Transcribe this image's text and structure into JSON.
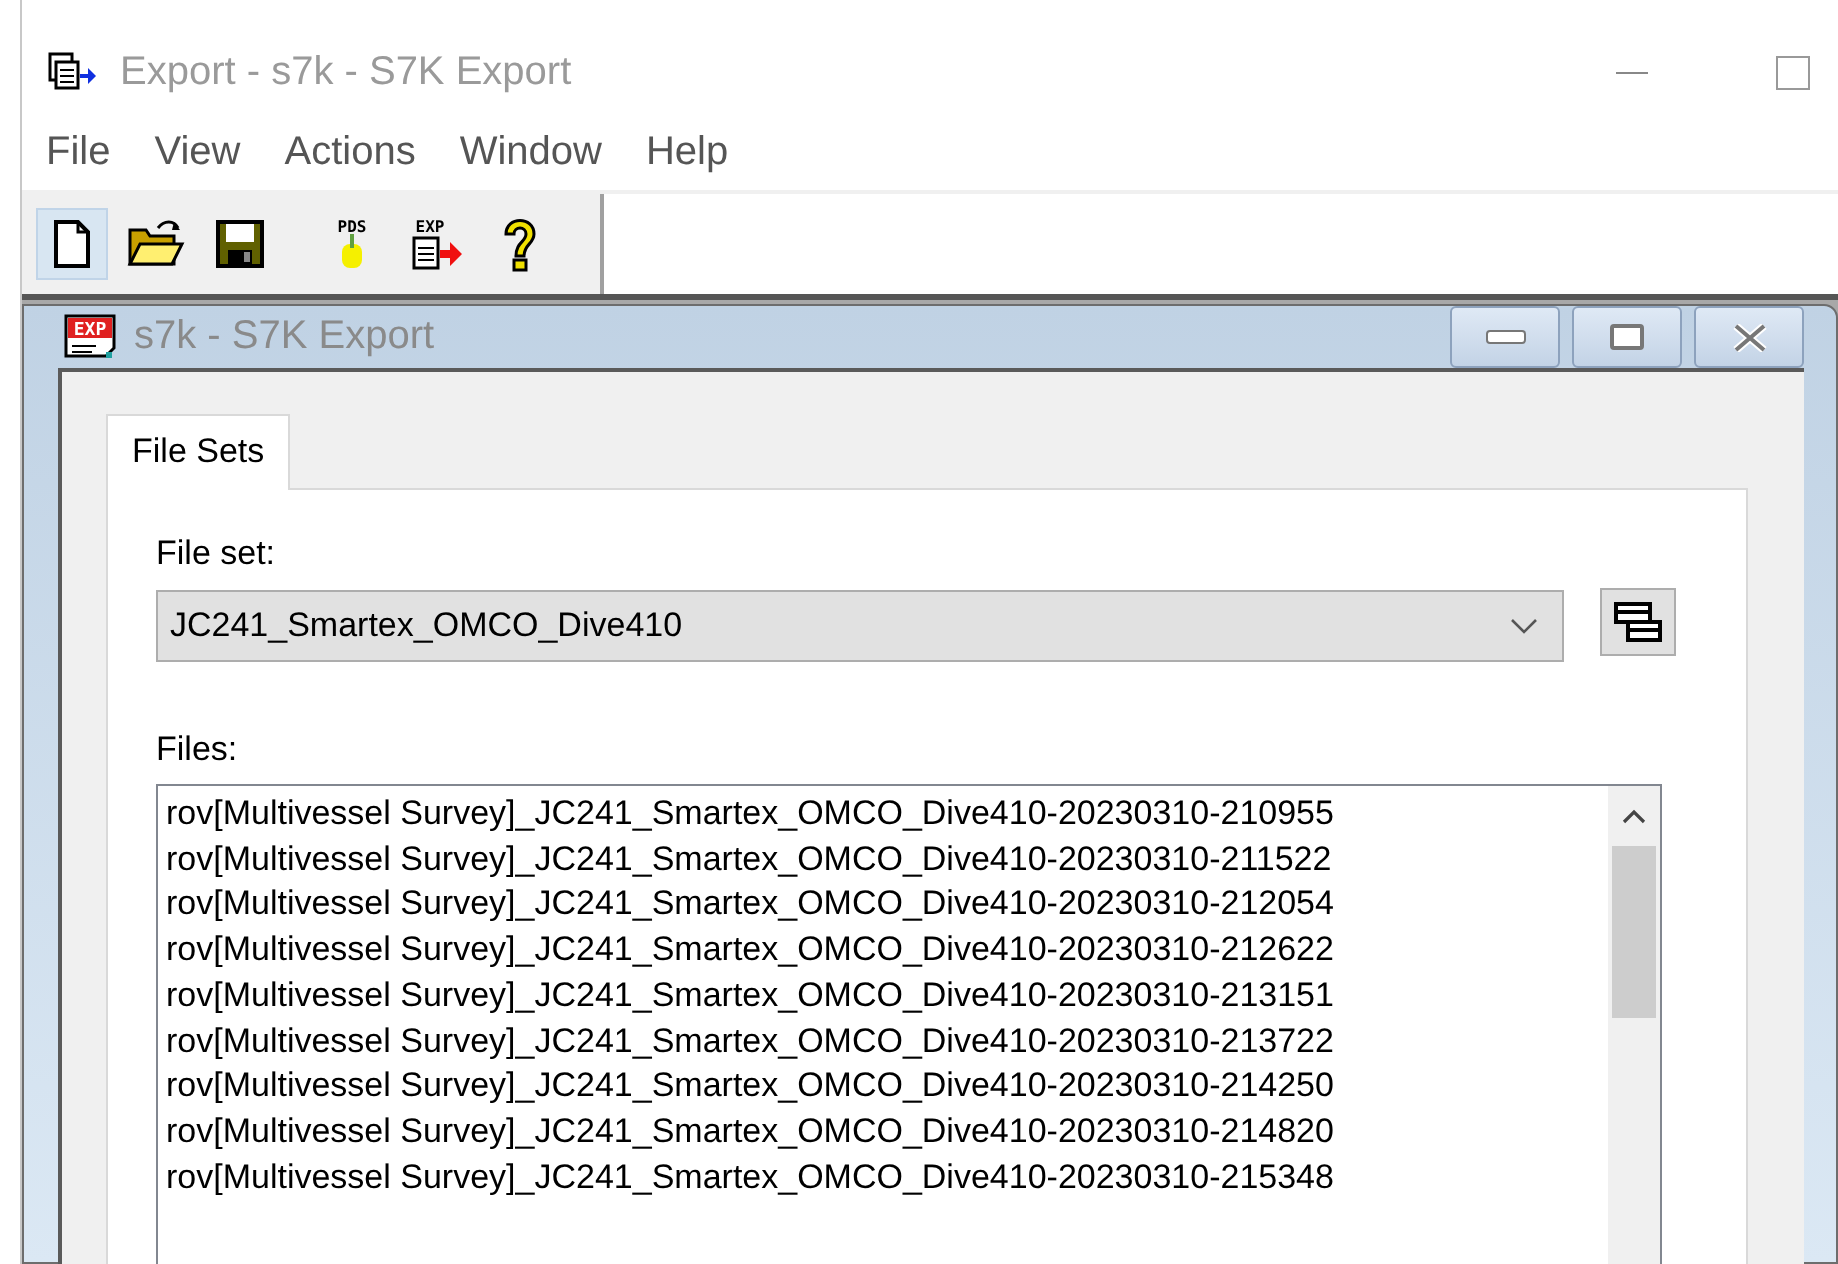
{
  "window": {
    "title": "Export - s7k - S7K Export"
  },
  "menu": [
    "File",
    "View",
    "Actions",
    "Window",
    "Help"
  ],
  "toolbar": [
    {
      "kind": "new",
      "hovered": true
    },
    {
      "kind": "open",
      "hovered": false
    },
    {
      "kind": "save",
      "hovered": false
    },
    {
      "kind": "pds",
      "badge": "PDS",
      "hovered": false
    },
    {
      "kind": "export",
      "badge": "EXP",
      "hovered": false
    },
    {
      "kind": "help",
      "hovered": false
    }
  ],
  "child_window": {
    "title": "s7k - S7K Export",
    "icon_badge": "EXP"
  },
  "tabs": [
    {
      "label": "File Sets",
      "selected": true
    }
  ],
  "file_set": {
    "label": "File set:",
    "value": "JC241_Smartex_OMCO_Dive410"
  },
  "files": {
    "label": "Files:",
    "items": [
      "rov[Multivessel Survey]_JC241_Smartex_OMCO_Dive410-20230310-210955",
      "rov[Multivessel Survey]_JC241_Smartex_OMCO_Dive410-20230310-211522",
      "rov[Multivessel Survey]_JC241_Smartex_OMCO_Dive410-20230310-212054",
      "rov[Multivessel Survey]_JC241_Smartex_OMCO_Dive410-20230310-212622",
      "rov[Multivessel Survey]_JC241_Smartex_OMCO_Dive410-20230310-213151",
      "rov[Multivessel Survey]_JC241_Smartex_OMCO_Dive410-20230310-213722",
      "rov[Multivessel Survey]_JC241_Smartex_OMCO_Dive410-20230310-214250",
      "rov[Multivessel Survey]_JC241_Smartex_OMCO_Dive410-20230310-214820",
      "rov[Multivessel Survey]_JC241_Smartex_OMCO_Dive410-20230310-215348"
    ]
  }
}
